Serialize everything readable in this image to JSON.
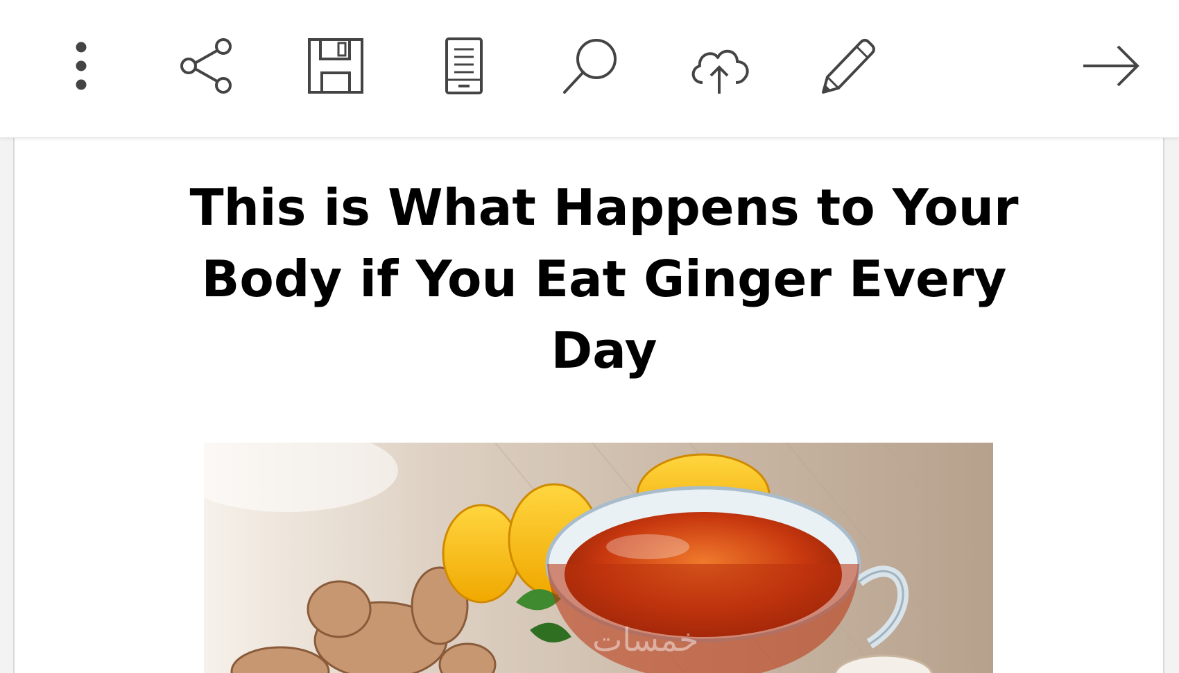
{
  "toolbar": {
    "buttons": [
      {
        "name": "more-options-button",
        "icon": "more-vertical-icon"
      },
      {
        "name": "share-button",
        "icon": "share-icon"
      },
      {
        "name": "save-button",
        "icon": "floppy-disk-icon"
      },
      {
        "name": "reading-view-button",
        "icon": "document-icon"
      },
      {
        "name": "search-button",
        "icon": "magnifier-icon"
      },
      {
        "name": "cloud-upload-button",
        "icon": "cloud-upload-icon"
      },
      {
        "name": "edit-button",
        "icon": "pencil-icon"
      },
      {
        "name": "next-button",
        "icon": "arrow-right-icon"
      }
    ],
    "icon_color": "#444444"
  },
  "document": {
    "title": "This is What Happens to Your Body if You Eat Ginger Every Day",
    "image": {
      "description_icon": "photo-ginger-tea",
      "watermark": "خمسات"
    }
  }
}
